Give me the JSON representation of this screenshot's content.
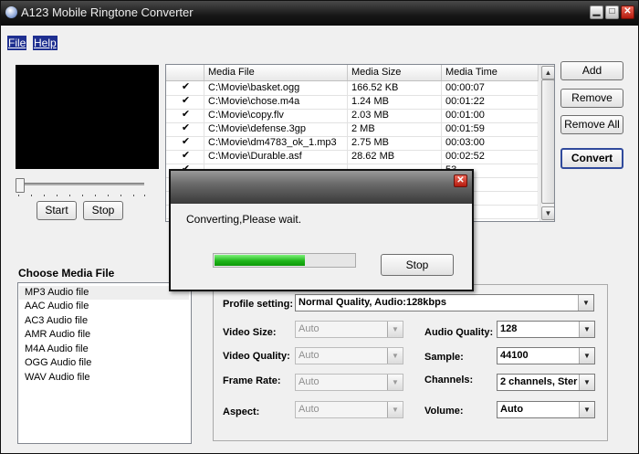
{
  "window": {
    "title": "A123 Mobile Ringtone Converter"
  },
  "menu": {
    "file": "File",
    "help": "Help"
  },
  "player": {
    "start_label": "Start",
    "stop_label": "Stop"
  },
  "actions": {
    "add": "Add",
    "remove": "Remove",
    "remove_all": "Remove All",
    "convert": "Convert"
  },
  "file_table": {
    "headers": [
      "",
      "Media File",
      "Media Size",
      "Media Time"
    ],
    "rows": [
      {
        "checked": true,
        "file": "C:\\Movie\\basket.ogg",
        "size": "166.52 KB",
        "time": "00:00:07"
      },
      {
        "checked": true,
        "file": "C:\\Movie\\chose.m4a",
        "size": "1.24 MB",
        "time": "00:01:22"
      },
      {
        "checked": true,
        "file": "C:\\Movie\\copy.flv",
        "size": "2.03 MB",
        "time": "00:01:00"
      },
      {
        "checked": true,
        "file": "C:\\Movie\\defense.3gp",
        "size": "2 MB",
        "time": "00:01:59"
      },
      {
        "checked": true,
        "file": "C:\\Movie\\dm4783_ok_1.mp3",
        "size": "2.75 MB",
        "time": "00:03:00"
      },
      {
        "checked": true,
        "file": "C:\\Movie\\Durable.asf",
        "size": "28.62 MB",
        "time": "00:02:52"
      },
      {
        "checked": true,
        "file": "",
        "size": "",
        "time": "53"
      },
      {
        "checked": true,
        "file": "",
        "size": "",
        "time": "30"
      },
      {
        "checked": true,
        "file": "",
        "size": "",
        "time": "41"
      },
      {
        "checked": true,
        "file": "",
        "size": "",
        "time": "33"
      }
    ]
  },
  "media_list": {
    "title": "Choose Media File",
    "items": [
      "MP3 Audio file",
      "AAC Audio file",
      "AC3 Audio file",
      "AMR Audio file",
      "M4A Audio file",
      "OGG Audio file",
      "WAV Audio file"
    ],
    "selected_index": 0
  },
  "settings": {
    "profile_label": "Profile setting:",
    "profile_value": "Normal Quality, Audio:128kbps",
    "video_size_label": "Video Size:",
    "video_size_value": "Auto",
    "video_quality_label": "Video Quality:",
    "video_quality_value": "Auto",
    "frame_rate_label": "Frame Rate:",
    "frame_rate_value": "Auto",
    "aspect_label": "Aspect:",
    "aspect_value": "Auto",
    "audio_quality_label": "Audio Quality:",
    "audio_quality_value": "128",
    "sample_label": "Sample:",
    "sample_value": "44100",
    "channels_label": "Channels:",
    "channels_value": "2 channels, Ster",
    "volume_label": "Volume:",
    "volume_value": "Auto"
  },
  "dialog": {
    "message": "Converting,Please wait.",
    "progress_percent": 65,
    "stop_label": "Stop"
  },
  "icons": {
    "app": "app-globe-icon",
    "minimize": "minimize-icon",
    "maximize": "maximize-icon",
    "close": "close-icon",
    "check": "checkmark-icon",
    "dropdown": "chevron-down-icon"
  },
  "colors": {
    "titlebar": "#161616",
    "menu_highlight": "#1e2f90",
    "progress": "#1fb51a",
    "close_button": "#b41a0e"
  }
}
